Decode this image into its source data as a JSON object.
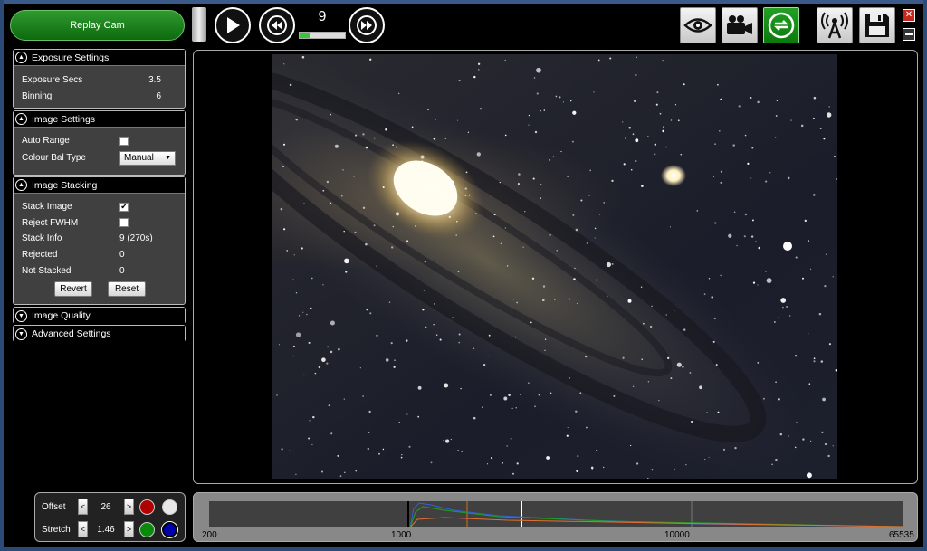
{
  "toolbar": {
    "replay_label": "Replay Cam",
    "frame_count": "9",
    "frame_progress_percent": 22
  },
  "panels": {
    "exposure": {
      "title": "Exposure Settings",
      "exposure_secs_label": "Exposure Secs",
      "exposure_secs_value": "3.5",
      "binning_label": "Binning",
      "binning_value": "6"
    },
    "image_settings": {
      "title": "Image Settings",
      "auto_range_label": "Auto Range",
      "auto_range_checked": false,
      "colour_bal_label": "Colour Bal Type",
      "colour_bal_value": "Manual"
    },
    "stacking": {
      "title": "Image Stacking",
      "stack_image_label": "Stack Image",
      "stack_image_checked": true,
      "reject_fwhm_label": "Reject FWHM",
      "reject_fwhm_checked": false,
      "stack_info_label": "Stack Info",
      "stack_info_value": "9 (270s)",
      "rejected_label": "Rejected",
      "rejected_value": "0",
      "not_stacked_label": "Not Stacked",
      "not_stacked_value": "0",
      "revert_label": "Revert",
      "reset_label": "Reset"
    },
    "image_quality": {
      "title": "Image Quality"
    },
    "advanced": {
      "title": "Advanced Settings"
    }
  },
  "levels": {
    "offset_label": "Offset",
    "offset_value": "26",
    "stretch_label": "Stretch",
    "stretch_value": "1.46",
    "colors": {
      "red": "#b00000",
      "white": "#e8e8e8",
      "green": "#0a8a0a",
      "blue": "#0000aa"
    }
  },
  "histogram": {
    "labels": [
      "200",
      "1000",
      "10000",
      "65535"
    ]
  },
  "icons": [
    "play-icon",
    "rewind-icon",
    "fast-forward-icon",
    "eye-icon",
    "video-camera-icon",
    "refresh-icon",
    "antenna-icon",
    "save-icon",
    "close-icon",
    "minimize-icon"
  ]
}
